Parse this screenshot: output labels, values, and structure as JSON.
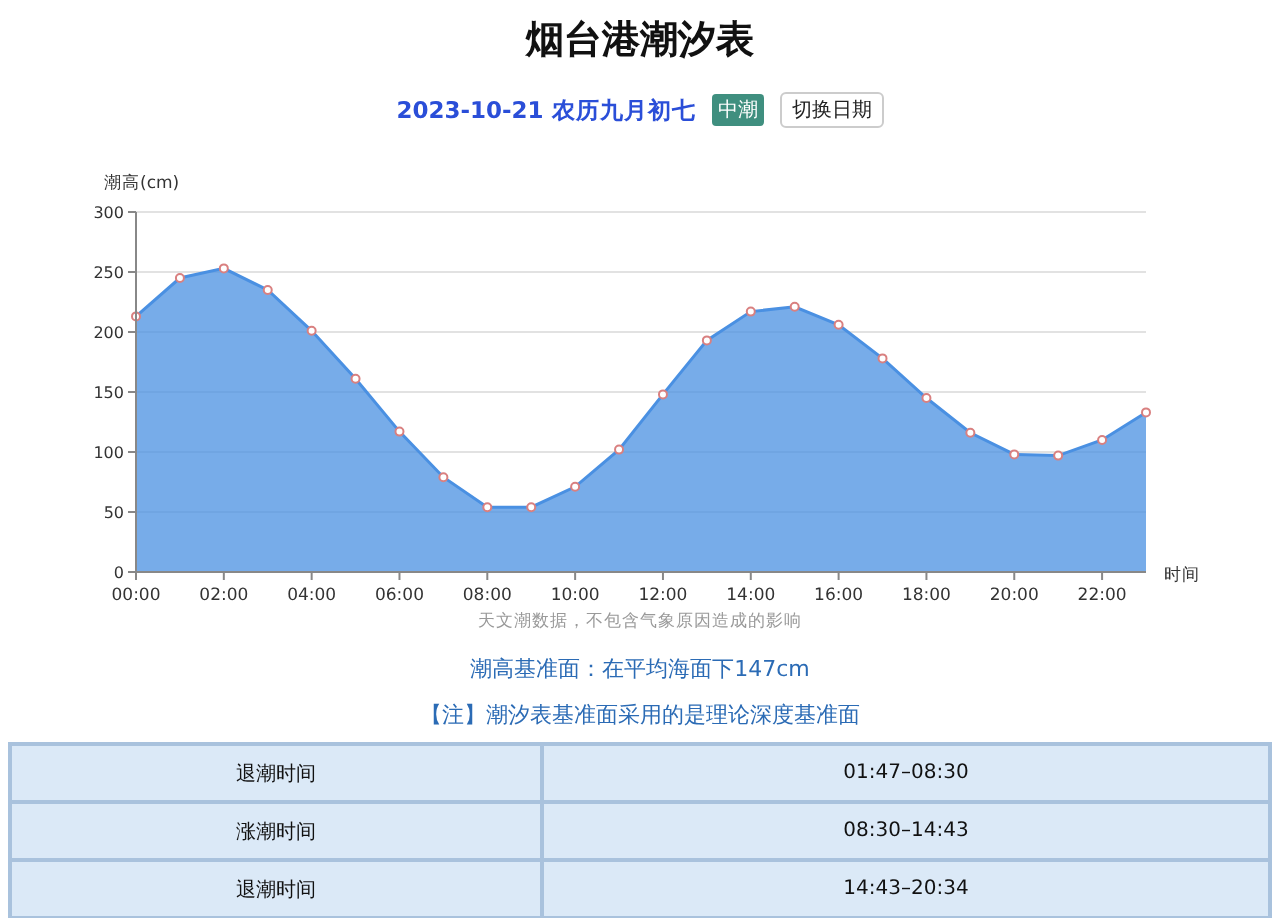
{
  "title": "烟台港潮汐表",
  "date_bar": {
    "date": "2023-10-21 农历九月初七",
    "tide_badge": "中潮",
    "switch_button": "切换日期"
  },
  "chart": {
    "chart_data": {
      "type": "area",
      "xlabel": "时间",
      "ylabel": "潮高(cm)",
      "x": [
        0,
        1,
        2,
        3,
        4,
        5,
        6,
        7,
        8,
        9,
        10,
        11,
        12,
        13,
        14,
        15,
        16,
        17,
        18,
        19,
        20,
        21,
        22,
        23
      ],
      "series": [
        {
          "color": "#4a90e2",
          "values": [
            213,
            245,
            253,
            235,
            201,
            161,
            117,
            79,
            54,
            54,
            71,
            102,
            148,
            193,
            217,
            221,
            206,
            178,
            145,
            116,
            98,
            97,
            110,
            133
          ]
        }
      ],
      "grid": true,
      "xlim": [
        0,
        23
      ],
      "ylim": [
        0,
        300
      ],
      "yticks": [
        0,
        50,
        100,
        150,
        200,
        250,
        300
      ],
      "xticks": [
        {
          "value": 0,
          "label": "00:00"
        },
        {
          "value": 2,
          "label": "02:00"
        },
        {
          "value": 4,
          "label": "04:00"
        },
        {
          "value": 6,
          "label": "06:00"
        },
        {
          "value": 8,
          "label": "08:00"
        },
        {
          "value": 10,
          "label": "10:00"
        },
        {
          "value": 12,
          "label": "12:00"
        },
        {
          "value": 14,
          "label": "14:00"
        },
        {
          "value": 16,
          "label": "16:00"
        },
        {
          "value": 18,
          "label": "18:00"
        },
        {
          "value": 20,
          "label": "20:00"
        },
        {
          "value": 22,
          "label": "22:00"
        }
      ]
    },
    "caption": "天文潮数据，不包含气象原因造成的影响"
  },
  "datum": "潮高基准面：在平均海面下147cm",
  "note": "【注】潮汐表基准面采用的是理论深度基准面",
  "tide_table": {
    "rows": [
      {
        "label": "退潮时间",
        "time": "01:47–08:30"
      },
      {
        "label": "涨潮时间",
        "time": "08:30–14:43"
      },
      {
        "label": "退潮时间",
        "time": "14:43–20:34"
      }
    ]
  }
}
